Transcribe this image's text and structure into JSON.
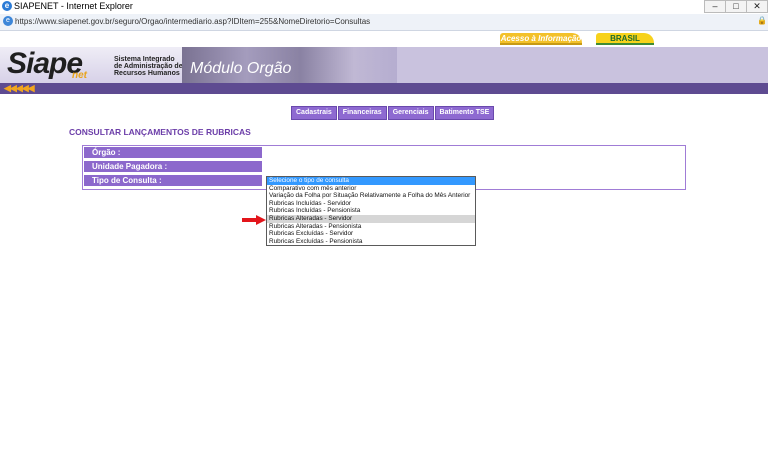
{
  "window": {
    "title": "SIAPENET - Internet Explorer",
    "ie_icon": "e",
    "minimize": "–",
    "maximize": "□",
    "close": "✕"
  },
  "address": {
    "url": "https://www.siapenet.gov.br/seguro/Orgao/intermediario.asp?IDItem=255&NomeDiretorio=Consultas",
    "lock_icon": "🔒"
  },
  "header": {
    "acesso": "Acesso à Informação",
    "brasil": "BRASIL",
    "logo_main": "Siape",
    "logo_net": "net",
    "logo_sub": "Sistema Integrado de Administração de Recursos Humanos",
    "module_title": "Módulo Orgão",
    "arrows": "◀◀◀◀◀"
  },
  "menu": {
    "items": [
      "Cadastrais",
      "Financeiras",
      "Gerenciais",
      "Batimento TSE"
    ]
  },
  "page_title": "CONSULTAR LANÇAMENTOS DE RUBRICAS",
  "form": {
    "orgao_label": "Órgão :",
    "unidade_label": "Unidade Pagadora :",
    "tipo_label": "Tipo de Consulta :"
  },
  "listbox": {
    "selected_index": 0,
    "hover_index": 5,
    "options": [
      "Selecione o tipo de consulta",
      "Comparativo com mês anterior",
      "Variação da Folha por Situação Relativamente a Folha do Mês Anterior",
      "Rubricas Incluídas - Servidor",
      "Rubricas Incluídas - Pensionista",
      "Rubricas Alteradas - Servidor",
      "Rubricas Alteradas - Pensionista",
      "Rubricas Excluídas - Servidor",
      "Rubricas Excluídas - Pensionista"
    ]
  },
  "colors": {
    "purple_dark": "#5e4b91",
    "purple_menu": "#8e6ad1",
    "title_purple": "#6b3da8",
    "select_blue": "#3399ff",
    "arrow_red": "#e3151b"
  }
}
